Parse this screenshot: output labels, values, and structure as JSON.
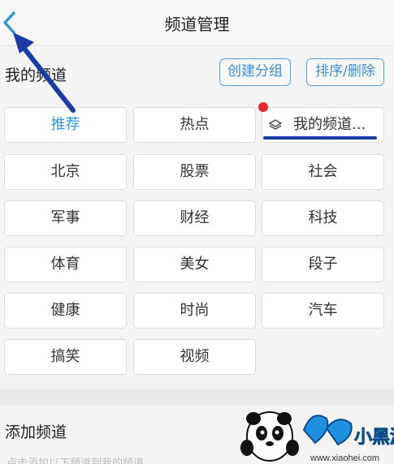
{
  "header": {
    "title": "频道管理",
    "back_icon": "chevron-left-icon"
  },
  "my_channels": {
    "title": "我的频道",
    "create_group_label": "创建分组",
    "sort_delete_label": "排序/删除",
    "channels": [
      {
        "label": "推荐",
        "state": "active"
      },
      {
        "label": "热点"
      },
      {
        "label": "我的频道...",
        "icon": "layers-icon",
        "badge": "red-dot"
      },
      {
        "label": "北京"
      },
      {
        "label": "股票"
      },
      {
        "label": "社会"
      },
      {
        "label": "军事"
      },
      {
        "label": "财经"
      },
      {
        "label": "科技"
      },
      {
        "label": "体育"
      },
      {
        "label": "美女"
      },
      {
        "label": "段子"
      },
      {
        "label": "健康"
      },
      {
        "label": "时尚"
      },
      {
        "label": "汽车"
      },
      {
        "label": "搞笑"
      },
      {
        "label": "视频"
      }
    ]
  },
  "add_channels": {
    "title": "添加频道",
    "hint": "点击添加以下频道到我的频道"
  },
  "watermark": {
    "text": "小黑游戏",
    "url_text": "www.xiaohei.com"
  },
  "colors": {
    "accent": "#2e98e0",
    "annotation": "#1a3ba8",
    "badge": "#e8272d"
  }
}
